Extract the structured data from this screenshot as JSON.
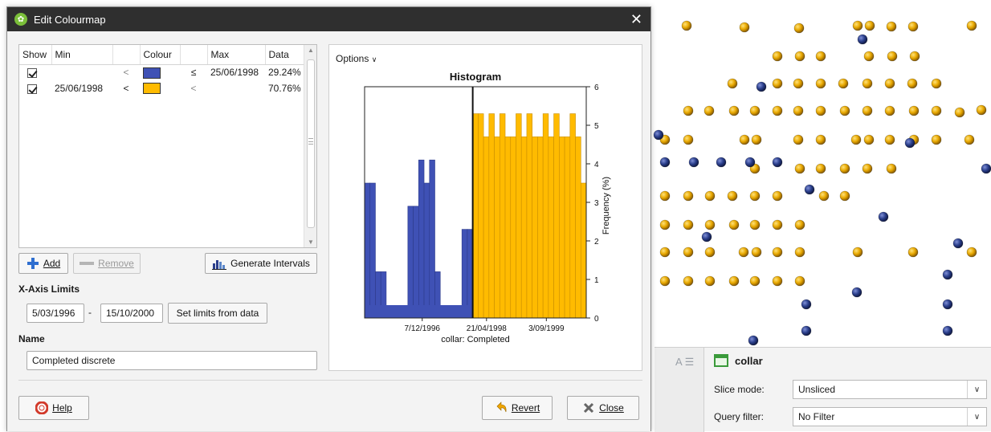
{
  "dialog": {
    "title": "Edit Colourmap",
    "close_glyph": "✕",
    "table": {
      "headers": [
        "Show",
        "Min",
        "",
        "Colour",
        "",
        "Max",
        "Data"
      ],
      "rows": [
        {
          "show": true,
          "min": "",
          "op1": "<",
          "colour": "#3f51b5",
          "op2": "≤",
          "max": "25/06/1998",
          "data": "29.24%"
        },
        {
          "show": true,
          "min": "25/06/1998",
          "op1": "<",
          "colour": "#ffbb00",
          "op2": "<",
          "max": "",
          "data": "70.76%"
        }
      ]
    },
    "buttons": {
      "add": "Add",
      "remove": "Remove",
      "generate": "Generate Intervals",
      "help": "Help",
      "revert": "Revert",
      "close": "Close",
      "set_limits": "Set limits from data"
    },
    "xaxis_limits": {
      "label": "X-Axis Limits",
      "min": "5/03/1996",
      "dash": "-",
      "max": "15/10/2000"
    },
    "name": {
      "label": "Name",
      "value": "Completed discrete"
    },
    "options_label": "Options"
  },
  "chart_data": {
    "type": "bar",
    "title": "Histogram",
    "xlabel": "collar: Completed",
    "ylabel": "Frequency (%)",
    "ylim": [
      0,
      6
    ],
    "yticks": [
      0,
      1,
      2,
      3,
      4,
      5,
      6
    ],
    "xtick_labels": [
      "7/12/1996",
      "21/04/1998",
      "3/09/1999"
    ],
    "threshold_label": "25/06/1998",
    "bin_count": 40,
    "series": [
      {
        "name": "",
        "color": "#3f51b5",
        "values": [
          3.5,
          3.5,
          1.2,
          1.2,
          0,
          0,
          0,
          0,
          2.9,
          2.9,
          4.1,
          3.5,
          4.1,
          1.2,
          0,
          0,
          0,
          0,
          2.3,
          2.3
        ]
      },
      {
        "name": "",
        "color": "#ffbb00",
        "values": [
          5.3,
          5.3,
          4.7,
          5.3,
          4.7,
          5.3,
          4.7,
          4.7,
          5.3,
          4.7,
          5.3,
          4.7,
          4.7,
          5.3,
          4.7,
          5.3,
          4.7,
          4.7,
          5.3,
          4.7,
          3.5
        ]
      }
    ]
  },
  "properties": {
    "object_name": "collar",
    "slice_mode_label": "Slice mode:",
    "slice_mode_value": "Unsliced",
    "query_filter_label": "Query filter:",
    "query_filter_value": "No Filter"
  },
  "scene": {
    "colors": {
      "gold": "#e8a800",
      "navy": "#2b3f8c"
    }
  }
}
